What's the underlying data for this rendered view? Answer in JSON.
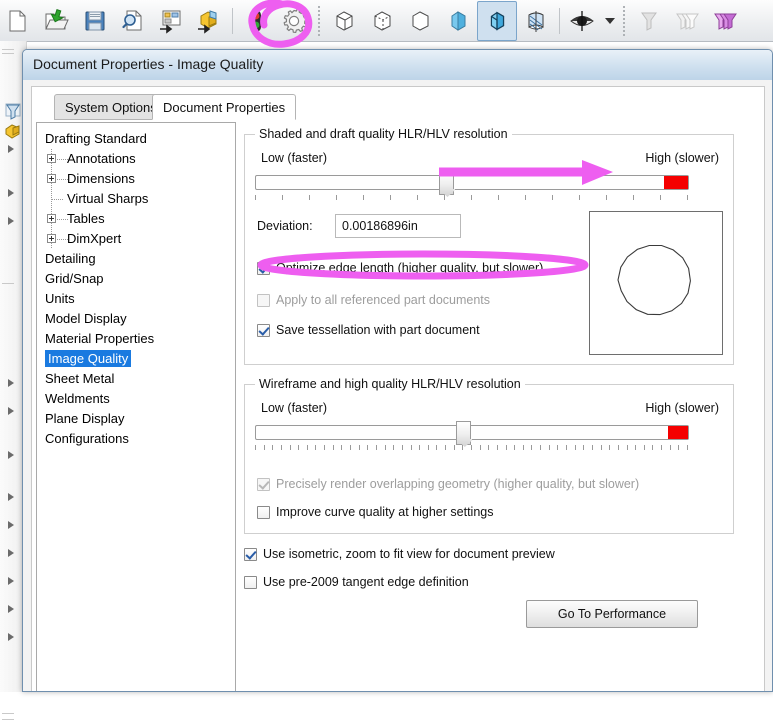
{
  "accent": {
    "annotation_color": "#ee66ee",
    "selection_blue": "#1a7ae0",
    "slider_red": "#f50000",
    "titlebar_blue": "#cfe0ef"
  },
  "toolbar": {
    "items": [
      {
        "name": "new-document-icon",
        "label": "New"
      },
      {
        "name": "open-document-icon",
        "label": "Open"
      },
      {
        "name": "save-icon",
        "label": "Save"
      },
      {
        "name": "print-preview-icon",
        "label": "Print Preview"
      },
      {
        "name": "make-drawing-icon",
        "label": "Make Drawing from Part"
      },
      {
        "name": "make-assembly-icon",
        "label": "Make Assembly from Part"
      },
      {
        "name": "rebuild-icon",
        "label": "Rebuild"
      },
      {
        "name": "options-gear-icon",
        "label": "Options"
      },
      {
        "name": "wireframe-icon",
        "label": "Wireframe"
      },
      {
        "name": "hidden-lines-visible-icon",
        "label": "Hidden Lines Visible"
      },
      {
        "name": "hidden-lines-removed-icon",
        "label": "Hidden Lines Removed"
      },
      {
        "name": "shaded-icon",
        "label": "Shaded"
      },
      {
        "name": "shaded-with-edges-icon",
        "label": "Shaded With Edges"
      },
      {
        "name": "section-view-icon",
        "label": "Section View"
      },
      {
        "name": "display-state-eye-icon",
        "label": "Display State"
      },
      {
        "name": "display-state-dropdown-icon",
        "label": "Display State dropdown"
      },
      {
        "name": "filter-icon",
        "label": "Filter"
      },
      {
        "name": "filter-multi-icon",
        "label": "Filter Multiple"
      },
      {
        "name": "filter-active-icon",
        "label": "Filter Active"
      }
    ]
  },
  "dialog": {
    "title": "Document Properties - Image Quality",
    "tabs": [
      {
        "label": "System Options",
        "active": false
      },
      {
        "label": "Document Properties",
        "active": true
      }
    ],
    "tree": [
      {
        "label": "Drafting Standard",
        "indent": 0,
        "expander": false,
        "selected": false
      },
      {
        "label": "Annotations",
        "indent": 1,
        "expander": true,
        "selected": false
      },
      {
        "label": "Dimensions",
        "indent": 1,
        "expander": true,
        "selected": false
      },
      {
        "label": "Virtual Sharps",
        "indent": 1,
        "expander": false,
        "selected": false
      },
      {
        "label": "Tables",
        "indent": 1,
        "expander": true,
        "selected": false
      },
      {
        "label": "DimXpert",
        "indent": 1,
        "expander": true,
        "selected": false
      },
      {
        "label": "Detailing",
        "indent": 0,
        "expander": false,
        "selected": false
      },
      {
        "label": "Grid/Snap",
        "indent": 0,
        "expander": false,
        "selected": false
      },
      {
        "label": "Units",
        "indent": 0,
        "expander": false,
        "selected": false
      },
      {
        "label": "Model Display",
        "indent": 0,
        "expander": false,
        "selected": false
      },
      {
        "label": "Material Properties",
        "indent": 0,
        "expander": false,
        "selected": false
      },
      {
        "label": "Image Quality",
        "indent": 0,
        "expander": false,
        "selected": true
      },
      {
        "label": "Sheet Metal",
        "indent": 0,
        "expander": false,
        "selected": false
      },
      {
        "label": "Weldments",
        "indent": 0,
        "expander": false,
        "selected": false
      },
      {
        "label": "Plane Display",
        "indent": 0,
        "expander": false,
        "selected": false
      },
      {
        "label": "Configurations",
        "indent": 0,
        "expander": false,
        "selected": false
      }
    ],
    "group1": {
      "title": "Shaded and draft quality HLR/HLV resolution",
      "low_label": "Low (faster)",
      "high_label": "High (slower)",
      "slider_percent": 44,
      "tick_count": 16,
      "deviation_label": "Deviation:",
      "deviation_value": "0.00186896in",
      "checkboxes": [
        {
          "label": "Optimize edge length (higher quality, but slower)",
          "checked": true,
          "disabled": false
        },
        {
          "label": "Apply to all referenced part documents",
          "checked": false,
          "disabled": true
        },
        {
          "label": "Save tessellation with part document",
          "checked": true,
          "disabled": false
        }
      ]
    },
    "group2": {
      "title": "Wireframe and high quality HLR/HLV resolution",
      "low_label": "Low (faster)",
      "high_label": "High (slower)",
      "slider_percent": 48,
      "tick_count": 50,
      "checkboxes": [
        {
          "label": "Precisely render overlapping geometry (higher quality, but slower)",
          "checked": true,
          "disabled": true
        },
        {
          "label": "Improve curve quality at higher settings",
          "checked": false,
          "disabled": false
        }
      ]
    },
    "footer_checkboxes": [
      {
        "label": "Use isometric, zoom to fit view for document preview",
        "checked": true,
        "disabled": false
      },
      {
        "label": "Use pre-2009 tangent edge definition",
        "checked": false,
        "disabled": false
      }
    ],
    "performance_button": "Go To Performance"
  },
  "annotations": [
    {
      "name": "gear-highlight-circle",
      "shape": "circle-scribble"
    },
    {
      "name": "slider-right-arrow",
      "shape": "arrow-right"
    },
    {
      "name": "optimize-edge-length-oval",
      "shape": "oval"
    }
  ]
}
